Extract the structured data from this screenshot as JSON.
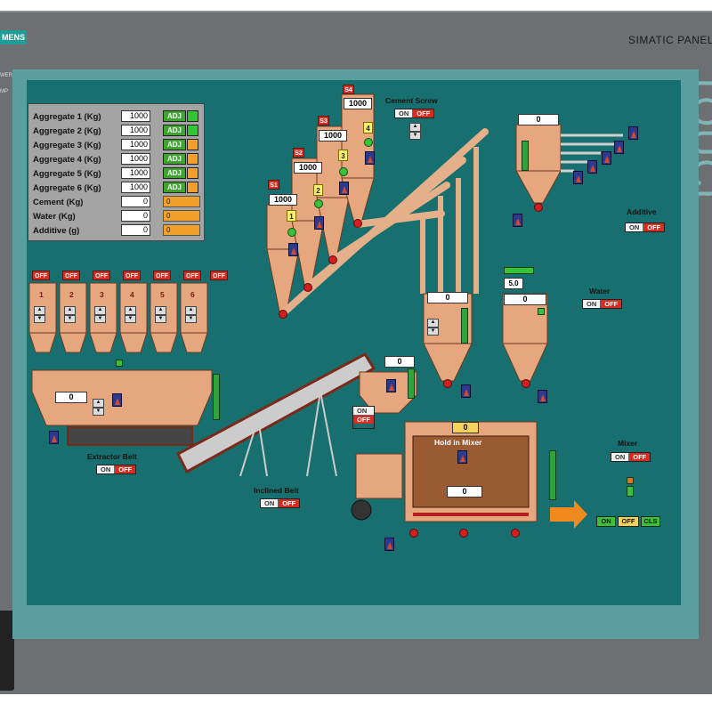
{
  "device": {
    "brand_logo": "MENS",
    "model": "SIMATIC PANEL",
    "side_text": "TOUCH",
    "power_label": "WER",
    "temp_label": "MP"
  },
  "colors": {
    "screen_bg": "#17706f",
    "bezel": "#6d7072",
    "silo": "#e6a77f",
    "off_red": "#d62d20",
    "ok_green": "#37c237",
    "adj_orange": "#f1a02a"
  },
  "recipe_panel": {
    "rows": [
      {
        "label": "Aggregate 1 (Kg)",
        "value": "1000",
        "adj": "ADJ"
      },
      {
        "label": "Aggregate 2 (Kg)",
        "value": "1000",
        "adj": "ADJ"
      },
      {
        "label": "Aggregate 3 (Kg)",
        "value": "1000",
        "adj": "ADJ"
      },
      {
        "label": "Aggregate 4 (Kg)",
        "value": "1000",
        "adj": "ADJ"
      },
      {
        "label": "Aggregate 5 (Kg)",
        "value": "1000",
        "adj": "ADJ"
      },
      {
        "label": "Aggregate 6 (Kg)",
        "value": "1000",
        "adj": "ADJ"
      },
      {
        "label": "Cement (Kg)",
        "value": "0",
        "actual": "0"
      },
      {
        "label": "Water (Kg)",
        "value": "0",
        "actual": "0"
      },
      {
        "label": "Additive (g)",
        "value": "0",
        "actual": "0"
      }
    ]
  },
  "cement_silos": [
    {
      "tag": "S1",
      "value": "1000",
      "num": "1"
    },
    {
      "tag": "S2",
      "value": "1000",
      "num": "2"
    },
    {
      "tag": "S3",
      "value": "1000",
      "num": "3"
    },
    {
      "tag": "S4",
      "value": "1000",
      "num": "4"
    }
  ],
  "cement_screw": {
    "label": "Cement Screw",
    "on": "ON",
    "off": "OFF"
  },
  "aggregate_bins": {
    "bins": [
      {
        "state": "OFF",
        "num": "1"
      },
      {
        "state": "OFF",
        "num": "2"
      },
      {
        "state": "OFF",
        "num": "3"
      },
      {
        "state": "OFF",
        "num": "4"
      },
      {
        "state": "OFF",
        "num": "5"
      },
      {
        "state": "OFF",
        "num": "6"
      }
    ],
    "extra_state": "OFF"
  },
  "hopper": {
    "value": "0"
  },
  "extractor_belt": {
    "label": "Extractor Belt",
    "on": "ON",
    "off": "OFF"
  },
  "inclined_belt": {
    "label": "Inclined Belt",
    "on": "ON",
    "off": "OFF"
  },
  "skip_hopper": {
    "value": "0",
    "on": "ON",
    "off": "OFF"
  },
  "additive": {
    "value": "0",
    "label": "Additive",
    "on": "ON",
    "off": "OFF"
  },
  "water": {
    "setpoint": "5.0",
    "value": "0",
    "label": "Water",
    "on": "ON",
    "off": "OFF"
  },
  "cement_weigher": {
    "value": "0"
  },
  "mixer": {
    "top_value": "0",
    "hold_label": "Hold in Mixer",
    "inner_value": "0",
    "label": "Mixer",
    "on": "ON",
    "off": "OFF",
    "btn_on": "ON",
    "btn_off": "OFF",
    "btn_cls": "CLS"
  }
}
